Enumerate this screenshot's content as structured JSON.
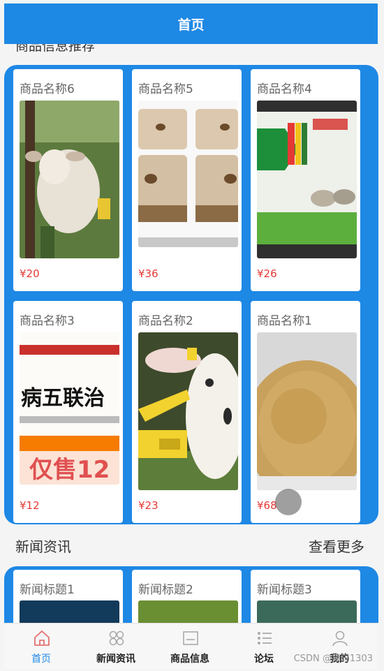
{
  "header": {
    "title": "首页"
  },
  "section_cut": {
    "title": "商品信息推荐"
  },
  "products": [
    {
      "name": "商品名称6",
      "price": "¥20",
      "image": "goat-eating-leaves"
    },
    {
      "name": "商品名称5",
      "price": "¥36",
      "image": "mineral-lick-blocks"
    },
    {
      "name": "商品名称4",
      "price": "¥26",
      "image": "medicine-box"
    },
    {
      "name": "商品名称3",
      "price": "¥12",
      "image": "poster-print"
    },
    {
      "name": "商品名称2",
      "price": "¥23",
      "image": "lamb-ear-tag"
    },
    {
      "name": "商品名称1",
      "price": "¥68",
      "image": "grain-feed"
    }
  ],
  "poster_text": {
    "line1": "病五联治",
    "line2": "仅售12"
  },
  "news": {
    "title": "新闻资讯",
    "more": "查看更多",
    "items": [
      {
        "title": "新闻标题1"
      },
      {
        "title": "新闻标题2"
      },
      {
        "title": "新闻标题3"
      }
    ]
  },
  "tabs": [
    {
      "label": "首页",
      "icon": "home-icon",
      "active": true
    },
    {
      "label": "新闻资讯",
      "icon": "grid-icon",
      "active": false
    },
    {
      "label": "商品信息",
      "icon": "goods-icon",
      "active": false
    },
    {
      "label": "论坛",
      "icon": "forum-icon",
      "active": false
    },
    {
      "label": "我的",
      "icon": "user-icon",
      "active": false
    }
  ],
  "watermark": "CSDN @猿码1303",
  "colors": {
    "primary": "#1e88e5",
    "price": "#e53935"
  }
}
